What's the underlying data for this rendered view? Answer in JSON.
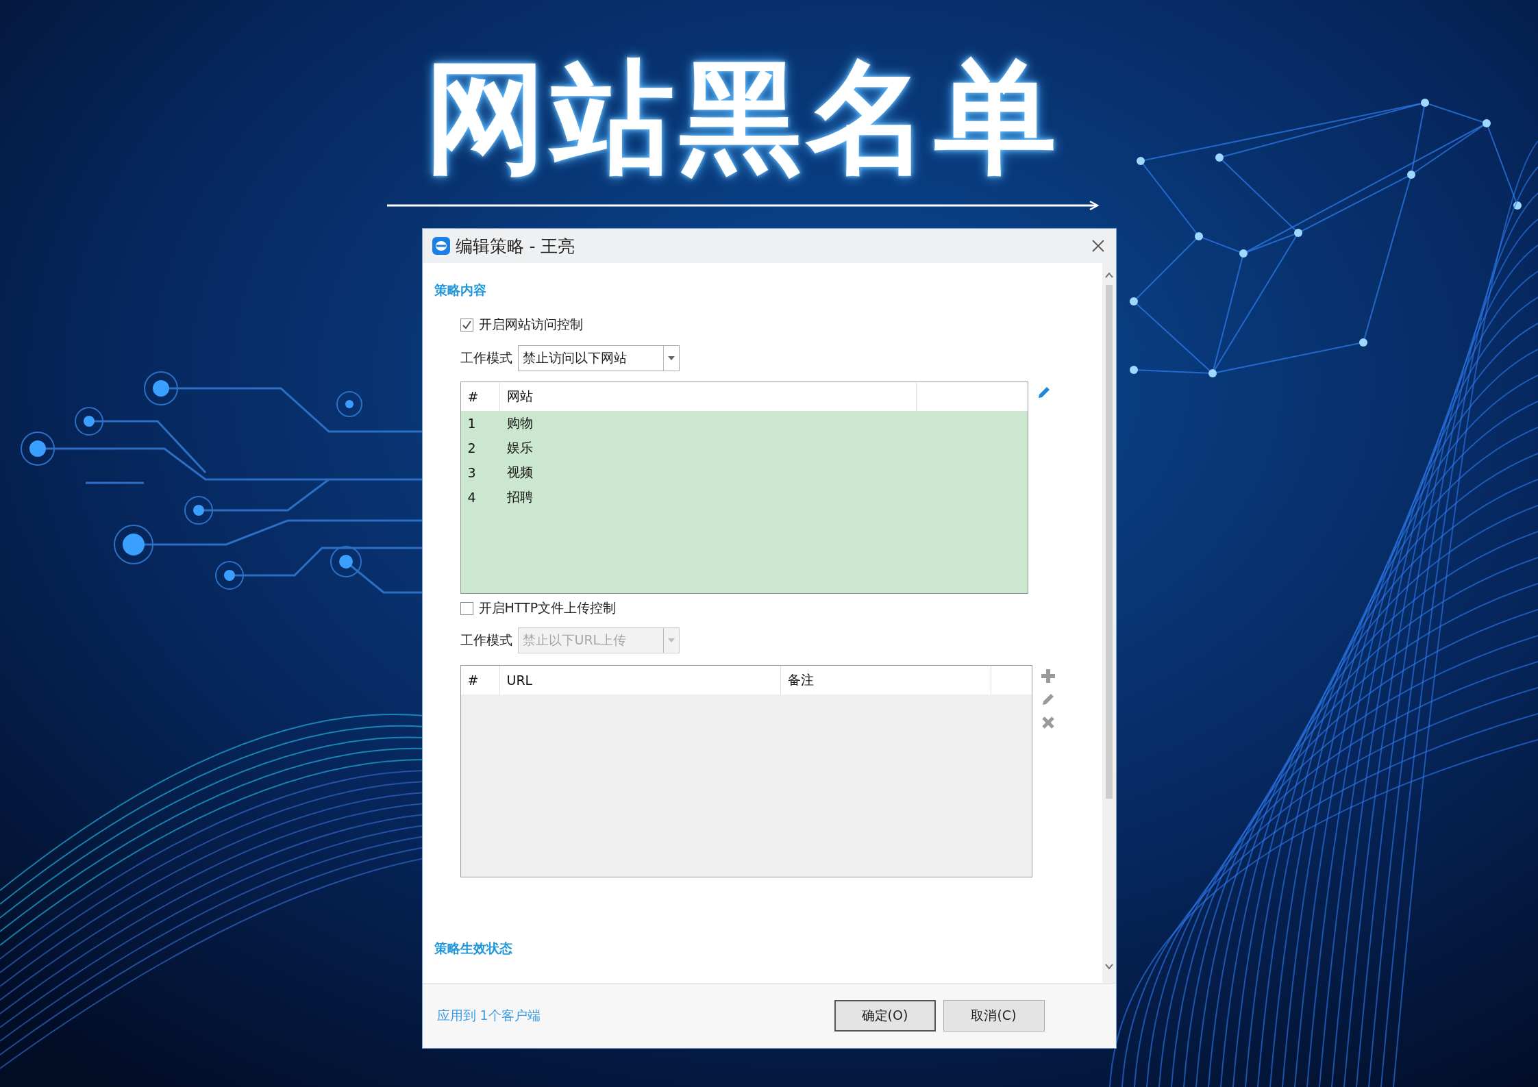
{
  "hero": {
    "title": "网站黑名单"
  },
  "dialog": {
    "title": "编辑策略 - 王亮",
    "content_section": {
      "title": "策略内容"
    },
    "controls": [
      {
        "label": "开启网站访问控制",
        "checked": true,
        "mode_label": "工作模式",
        "mode": {
          "value": "禁止访问以下网站",
          "disabled": false
        },
        "tools": [
          {
            "kind": "edit"
          }
        ],
        "table": {
          "columns": [
            "#",
            "网站"
          ],
          "rows": [
            [
              "1",
              "购物"
            ],
            [
              "2",
              "娱乐"
            ],
            [
              "3",
              "视频"
            ],
            [
              "4",
              "招聘"
            ]
          ]
        }
      },
      {
        "label": "开启HTTP文件上传控制",
        "checked": false,
        "mode_label": "工作模式",
        "mode": {
          "value": "禁止以下URL上传",
          "disabled": true
        },
        "tools": [
          {
            "kind": "add"
          },
          {
            "kind": "edit"
          },
          {
            "kind": "delete"
          }
        ],
        "table": {
          "columns": [
            "#",
            "URL",
            "备注"
          ]
        }
      }
    ],
    "status_section": {
      "title": "策略生效状态"
    },
    "footer": {
      "link": "应用到 1个客户端",
      "buttons": [
        "确定(O)",
        "取消(C)"
      ]
    }
  }
}
